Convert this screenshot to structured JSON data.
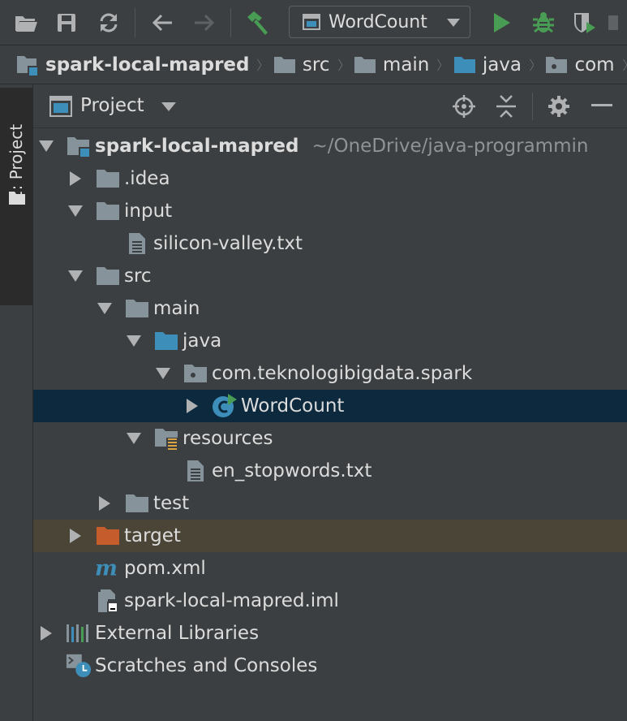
{
  "toolbar": {
    "run_config": "WordCount",
    "icons": [
      "open-folder-icon",
      "save-icon",
      "sync-icon",
      "back-arrow-icon",
      "forward-arrow-icon",
      "build-hammer-icon",
      "run-icon",
      "debug-bug-icon",
      "coverage-shield-icon",
      "stop-icon"
    ]
  },
  "breadcrumb": [
    {
      "label": "spark-local-mapred",
      "icon": "module-icon"
    },
    {
      "label": "src",
      "icon": "folder-icon"
    },
    {
      "label": "main",
      "icon": "folder-icon"
    },
    {
      "label": "java",
      "icon": "source-folder-icon"
    },
    {
      "label": "com",
      "icon": "package-icon"
    }
  ],
  "side_tab": {
    "label": "1: Project"
  },
  "panel": {
    "title": "Project"
  },
  "tree": [
    {
      "label": "spark-local-mapred",
      "path": "~/OneDrive/java-programmin",
      "depth": 0,
      "arrow": "down",
      "icon": "module-icon",
      "bold": true
    },
    {
      "label": ".idea",
      "depth": 1,
      "arrow": "right",
      "icon": "folder-icon"
    },
    {
      "label": "input",
      "depth": 1,
      "arrow": "down",
      "icon": "folder-icon"
    },
    {
      "label": "silicon-valley.txt",
      "depth": 2,
      "arrow": "none",
      "icon": "text-file-icon"
    },
    {
      "label": "src",
      "depth": 1,
      "arrow": "down",
      "icon": "folder-icon"
    },
    {
      "label": "main",
      "depth": 2,
      "arrow": "down",
      "icon": "folder-icon"
    },
    {
      "label": "java",
      "depth": 3,
      "arrow": "down",
      "icon": "source-folder-icon"
    },
    {
      "label": "com.teknologibigdata.spark",
      "depth": 4,
      "arrow": "down",
      "icon": "package-icon"
    },
    {
      "label": "WordCount",
      "depth": 5,
      "arrow": "right",
      "icon": "java-class-icon",
      "selected": true
    },
    {
      "label": "resources",
      "depth": 3,
      "arrow": "down",
      "icon": "resources-folder-icon"
    },
    {
      "label": "en_stopwords.txt",
      "depth": 4,
      "arrow": "none",
      "icon": "text-file-icon"
    },
    {
      "label": "test",
      "depth": 2,
      "arrow": "right",
      "icon": "folder-icon"
    },
    {
      "label": "target",
      "depth": 1,
      "arrow": "right",
      "icon": "excluded-folder-icon",
      "excluded": true
    },
    {
      "label": "pom.xml",
      "depth": 1,
      "arrow": "none",
      "icon": "maven-icon"
    },
    {
      "label": "spark-local-mapred.iml",
      "depth": 1,
      "arrow": "none",
      "icon": "iml-file-icon"
    },
    {
      "label": "External Libraries",
      "depth": 0,
      "arrow": "right",
      "icon": "libraries-icon"
    },
    {
      "label": "Scratches and Consoles",
      "depth": 0,
      "arrow": "none",
      "icon": "scratches-icon"
    }
  ],
  "colors": {
    "background": "#3c3f41",
    "selection": "#0d293e",
    "excluded": "#4b4538",
    "run_green": "#499c54",
    "folder": "#87939a",
    "source_folder": "#3d8eb9",
    "target_folder": "#c45c2b"
  }
}
